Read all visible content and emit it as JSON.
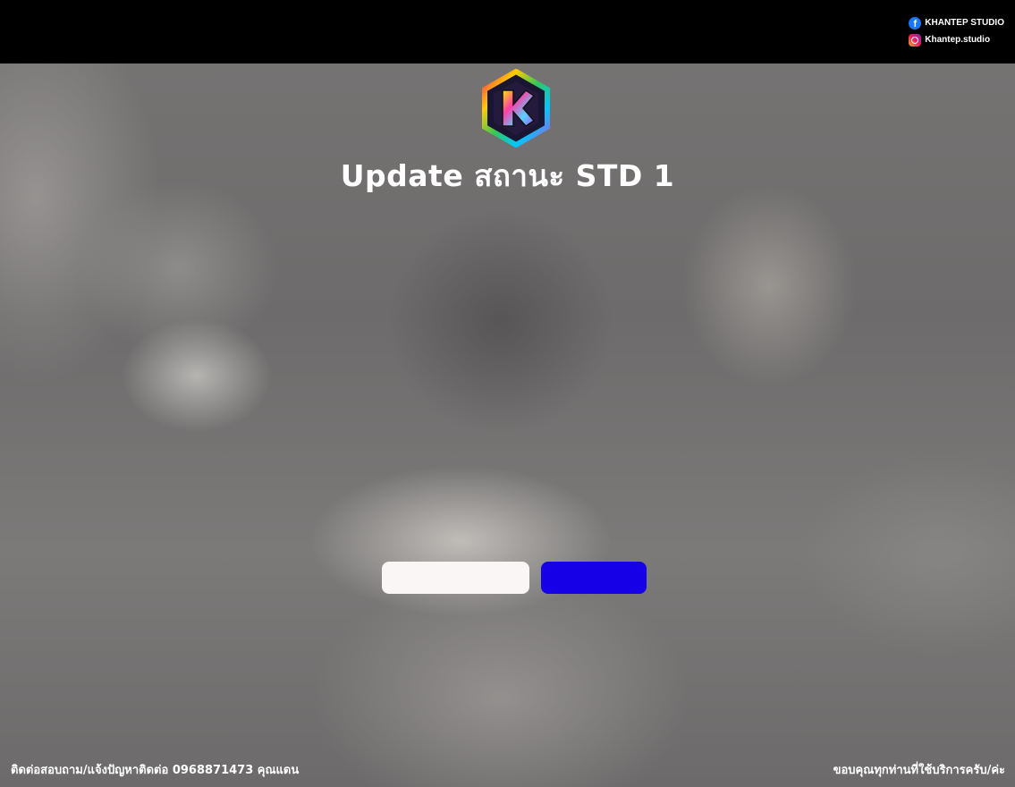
{
  "header": {
    "facebook_label": "KHANTEP STUDIO",
    "instagram_label": "Khantep.studio",
    "facebook_icon": "facebook-icon",
    "instagram_icon": "instagram-icon"
  },
  "brand": {
    "logo_icon": "k-hexagon-logo",
    "logo_letter": "K"
  },
  "main": {
    "title": "Update สถานะ STD 1",
    "buttons": [
      {
        "label": "",
        "color": "#faf6f5"
      },
      {
        "label": "",
        "color": "#1500e8"
      }
    ]
  },
  "footer": {
    "left_text": "ติดต่อสอบถาม/แจ้งปัญหาติดต่อ 0968871473 คุณแดน",
    "right_text": "ขอบคุณทุกท่านที่ใช้บริการครับ/ค่ะ"
  },
  "colors": {
    "topbar": "#000000",
    "accent_blue": "#1500e8",
    "button_light": "#faf6f5"
  }
}
